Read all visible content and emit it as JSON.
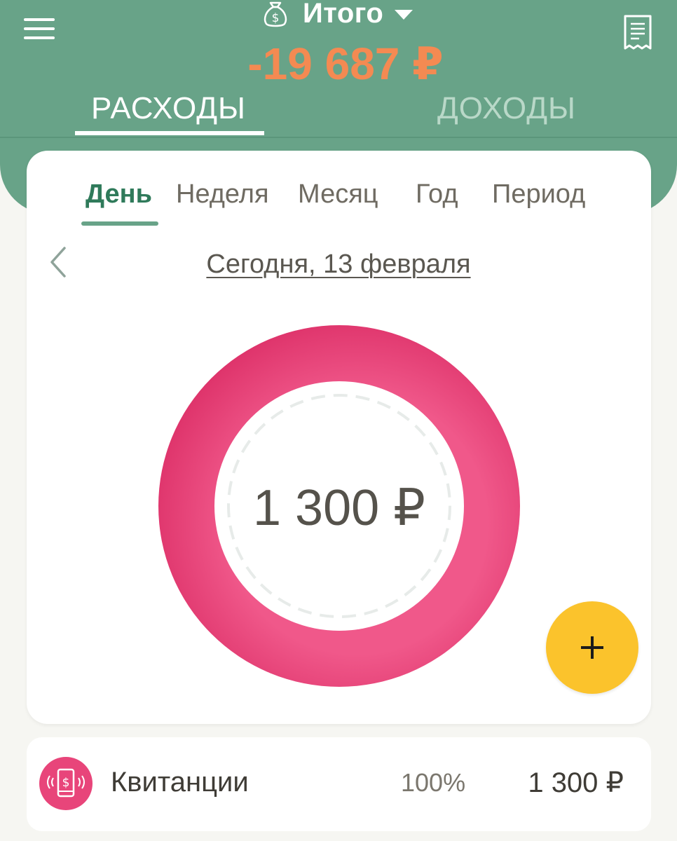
{
  "header": {
    "title": "Итого",
    "total": "-19 687 ₽",
    "tabs": [
      {
        "label": "РАСХОДЫ",
        "active": true
      },
      {
        "label": "ДОХОДЫ",
        "active": false
      }
    ],
    "icons": {
      "menu": "hamburger-menu-icon",
      "title": "money-bag-icon",
      "dropdown": "caret-down-icon",
      "right": "receipt-icon"
    }
  },
  "periods": {
    "tabs": [
      {
        "label": "День",
        "active": true
      },
      {
        "label": "Неделя",
        "active": false
      },
      {
        "label": "Месяц",
        "active": false
      },
      {
        "label": "Год",
        "active": false
      },
      {
        "label": "Период",
        "active": false
      }
    ],
    "date_label": "Сегодня, 13 февраля"
  },
  "chart_data": {
    "type": "pie",
    "categories": [
      "Квитанции"
    ],
    "values": [
      1300
    ],
    "center_label": "1 300 ₽"
  },
  "categories": [
    {
      "name": "Квитанции",
      "percent": "100%",
      "amount": "1 300 ₽",
      "icon": "phone-payment-icon"
    }
  ],
  "colors": {
    "header": "#68a388",
    "accent_total": "#f48a52",
    "active_period": "#2f7a5a",
    "donut": "#e33d74",
    "fab": "#fbc32c"
  }
}
